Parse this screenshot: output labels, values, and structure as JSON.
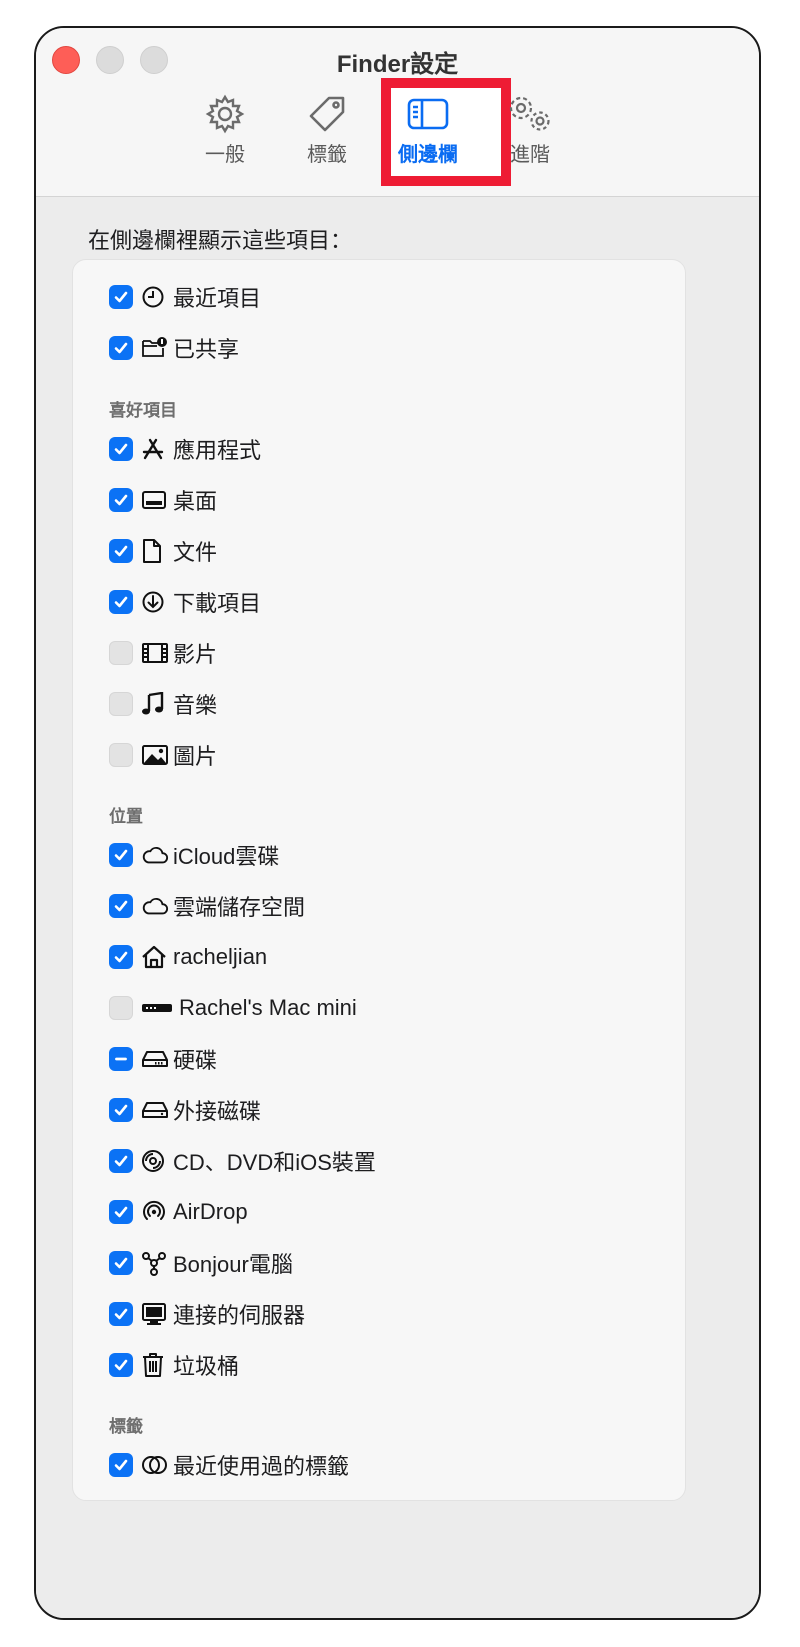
{
  "window": {
    "title": "Finder設定"
  },
  "tabs": [
    {
      "label": "一般",
      "icon": "gear-icon"
    },
    {
      "label": "標籤",
      "icon": "tag-icon"
    },
    {
      "label": "側邊欄",
      "icon": "sidebar-icon"
    },
    {
      "label": "進階",
      "icon": "gears-icon"
    }
  ],
  "heading": "在側邊欄裡顯示這些項目：",
  "top_items": [
    {
      "label": "最近項目",
      "state": "checked",
      "icon": "clock-icon"
    },
    {
      "label": "已共享",
      "state": "checked",
      "icon": "shared-folder-icon"
    }
  ],
  "sections": {
    "favorites": "喜好項目",
    "locations": "位置",
    "tags": "標籤"
  },
  "favorites": [
    {
      "label": "應用程式",
      "state": "checked",
      "icon": "applications-icon"
    },
    {
      "label": "桌面",
      "state": "checked",
      "icon": "desktop-icon"
    },
    {
      "label": "文件",
      "state": "checked",
      "icon": "document-icon"
    },
    {
      "label": "下載項目",
      "state": "checked",
      "icon": "download-icon"
    },
    {
      "label": "影片",
      "state": "unchecked",
      "icon": "film-icon"
    },
    {
      "label": "音樂",
      "state": "unchecked",
      "icon": "music-icon"
    },
    {
      "label": "圖片",
      "state": "unchecked",
      "icon": "photo-icon"
    }
  ],
  "locations": [
    {
      "label": "iCloud雲碟",
      "state": "checked",
      "icon": "cloud-icon"
    },
    {
      "label": "雲端儲存空間",
      "state": "checked",
      "icon": "cloud-icon"
    },
    {
      "label": "racheljian",
      "state": "checked",
      "icon": "home-icon"
    },
    {
      "label": "Rachel's Mac mini",
      "state": "unchecked",
      "icon": "mac-mini-icon"
    },
    {
      "label": "硬碟",
      "state": "mixed",
      "icon": "drive-icon"
    },
    {
      "label": "外接磁碟",
      "state": "checked",
      "icon": "external-drive-icon"
    },
    {
      "label": "CD、DVD和iOS裝置",
      "state": "checked",
      "icon": "disc-icon"
    },
    {
      "label": "AirDrop",
      "state": "checked",
      "icon": "airdrop-icon"
    },
    {
      "label": "Bonjour電腦",
      "state": "checked",
      "icon": "bonjour-icon"
    },
    {
      "label": "連接的伺服器",
      "state": "checked",
      "icon": "server-icon"
    },
    {
      "label": "垃圾桶",
      "state": "checked",
      "icon": "trash-icon"
    }
  ],
  "tag_items": [
    {
      "label": "最近使用過的標籤",
      "state": "checked",
      "icon": "tag-circles-icon"
    }
  ],
  "colors": {
    "accent": "#0b72f5",
    "highlight": "#ee1c34"
  }
}
